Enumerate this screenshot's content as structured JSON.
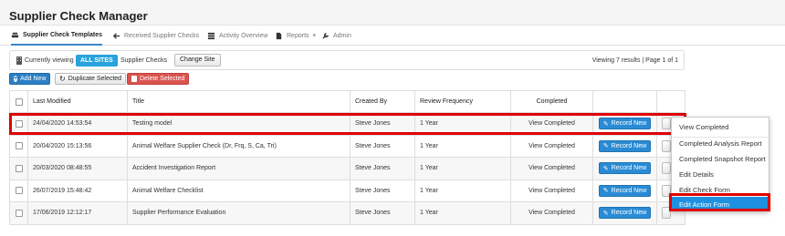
{
  "app": {
    "title": "Supplier Check Manager"
  },
  "nav": {
    "tabs": [
      {
        "label": "Supplier Check Templates",
        "icon": "stack-icon"
      },
      {
        "label": "Received Supplier Checks",
        "icon": "arrow-left-icon"
      },
      {
        "label": "Activity Overview",
        "icon": "list-icon"
      },
      {
        "label": "Reports",
        "icon": "document-icon"
      },
      {
        "label": "Admin",
        "icon": "wrench-icon"
      }
    ]
  },
  "filter": {
    "currently_viewing": "Currently viewing",
    "site_badge": "ALL SITES",
    "site_suffix": "Supplier Checks",
    "change_site": "Change Site",
    "results": "Viewing 7 results | Page 1 of 1"
  },
  "actions": {
    "add_new": "Add New",
    "duplicate": "Duplicate Selected",
    "delete": "Delete Selected"
  },
  "table": {
    "headers": [
      "Last Modified",
      "Title",
      "Created By",
      "Review Frequency",
      "Completed"
    ],
    "rows": [
      {
        "last_modified": "24/04/2020 14:53:54",
        "title": "Testing model",
        "created_by": "Steve Jones",
        "frequency": "1 Year",
        "completed": "View Completed",
        "action": "Record New"
      },
      {
        "last_modified": "20/04/2020 15:13:56",
        "title": "Animal Welfare Supplier Check (Dr, Frq, S, Ca, Tri)",
        "created_by": "Steve Jones",
        "frequency": "1 Year",
        "completed": "View Completed",
        "action": "Record New"
      },
      {
        "last_modified": "20/03/2020 08:48:55",
        "title": "Accident Investigation Report",
        "created_by": "Steve Jones",
        "frequency": "1 Year",
        "completed": "View Completed",
        "action": "Record New"
      },
      {
        "last_modified": "26/07/2019 15:48:42",
        "title": "Animal Welfare Checklist",
        "created_by": "Steve Jones",
        "frequency": "1 Year",
        "completed": "View Completed",
        "action": "Record New"
      },
      {
        "last_modified": "17/06/2019 12:12:17",
        "title": "Supplier Performance Evaluation",
        "created_by": "Steve Jones",
        "frequency": "1 Year",
        "completed": "View Completed",
        "action": "Record New"
      }
    ]
  },
  "dropdown": {
    "items": [
      "View Completed",
      "Completed Analysis Report",
      "Completed Snapshot Report",
      "Edit Details",
      "Edit Check Form",
      "Edit Action Form"
    ],
    "active_index": 5
  },
  "colors": {
    "accent": "#29a3dc",
    "primary_button": "#2a8bd4",
    "danger": "#d9534f",
    "highlight": "#e00000",
    "menu_active": "#1e90e0"
  }
}
